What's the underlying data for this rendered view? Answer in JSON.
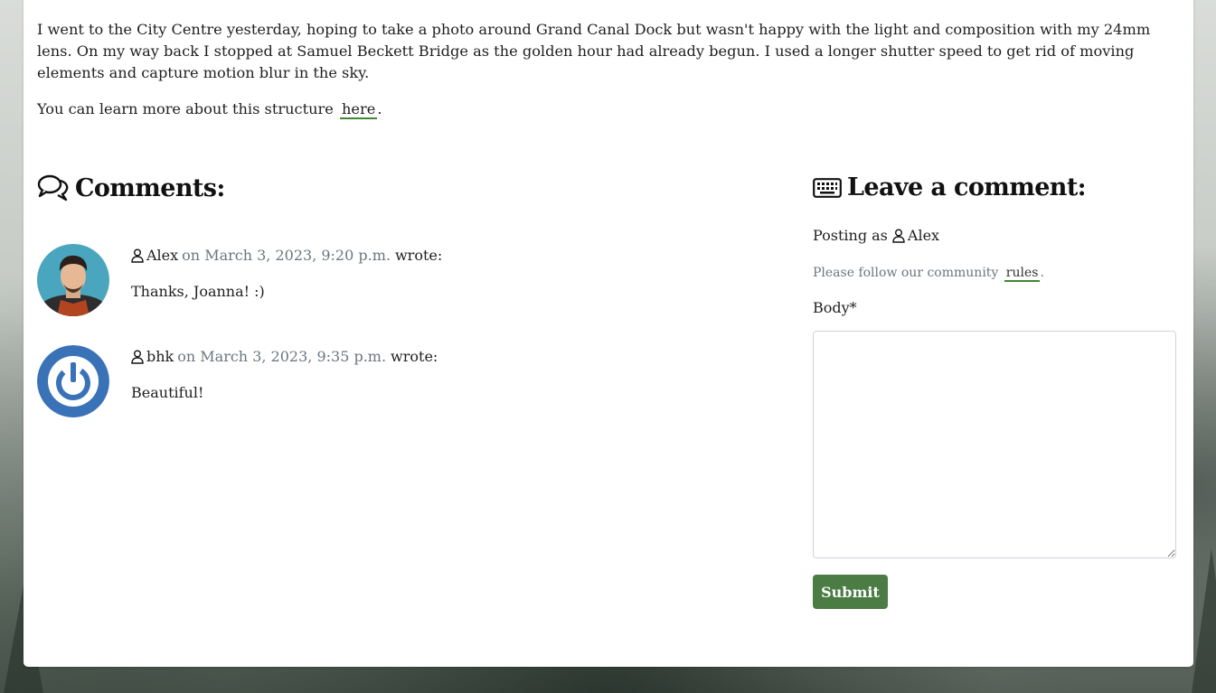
{
  "post": {
    "intro_text": "I went to the City Centre yesterday, hoping to take a photo around Grand Canal Dock but wasn't happy with the light and composition with my 24mm lens. On my way back I stopped at Samuel Beckett Bridge as the golden hour had already begun. I used a longer shutter speed to get rid of moving elements and capture motion blur in the sky.",
    "learn_more_prefix": "You can learn more about this structure",
    "learn_more_link": "here",
    "learn_more_suffix": "."
  },
  "comments_section": {
    "title": "Comments:",
    "icon": "chat-bubbles-icon",
    "items": [
      {
        "author": "Alex",
        "date": "on March 3, 2023, 9:20 p.m.",
        "wrote": "wrote:",
        "body": "Thanks, Joanna! :)",
        "avatar": "photo-avatar"
      },
      {
        "author": "bhk",
        "date": "on March 3, 2023, 9:35 p.m.",
        "wrote": "wrote:",
        "body": "Beautiful!",
        "avatar": "power-symbol-avatar"
      }
    ]
  },
  "comment_form": {
    "title": "Leave a comment:",
    "icon": "keyboard-icon",
    "posting_as_label": "Posting as",
    "posting_as_user": "Alex",
    "rules_prefix": "Please follow our community",
    "rules_link": "rules",
    "rules_suffix": ".",
    "body_label": "Body*",
    "body_value": "",
    "submit_label": "Submit"
  },
  "colors": {
    "link_underline": "#3f8a2e",
    "submit_button": "#4a7c43",
    "muted_text": "#6c757d",
    "avatar_blue": "#3a72b8"
  }
}
